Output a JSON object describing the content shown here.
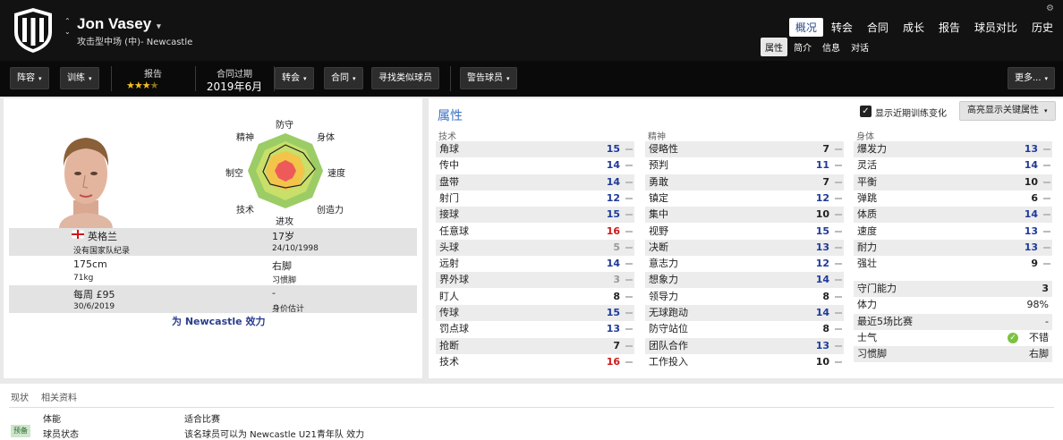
{
  "player": {
    "name": "Jon Vasey",
    "position": "攻击型中场 (中)- Newcastle"
  },
  "tabs": [
    "概况",
    "转会",
    "合同",
    "成长",
    "报告",
    "球员对比",
    "历史"
  ],
  "subtabs": [
    "属性",
    "简介",
    "信息",
    "对话"
  ],
  "toolbar": {
    "squad": "阵容",
    "training": "训练",
    "report_label": "报告",
    "report_stars": "★★★",
    "report_half": "★",
    "contract_label": "合同过期",
    "contract_value": "2019年6月",
    "transfer": "转会",
    "contract": "合同",
    "find_similar": "寻找类似球员",
    "warn": "警告球员",
    "more": "更多..."
  },
  "radar": {
    "defense": "防守",
    "physical": "身体",
    "speed": "速度",
    "creativity": "创造力",
    "attack": "进攻",
    "technique": "技术",
    "control": "制空",
    "mental": "精神"
  },
  "info": {
    "nation": "英格兰",
    "nation_note": "没有国家队纪录",
    "age": "17岁",
    "dob": "24/10/1998",
    "height": "175cm",
    "weight": "71kg",
    "foot": "右脚",
    "foot_label": "习惯脚",
    "wage": "每周 £95",
    "contract_end": "30/6/2019",
    "value": "-",
    "value_label": "身价估计",
    "plays_for": "为 Newcastle 效力"
  },
  "attributes": {
    "title": "属性",
    "show_training": "显示近期训练变化",
    "highlight": "高亮显示关键属性",
    "technical_header": "技术",
    "mental_header": "精神",
    "physical_header": "身体",
    "technical": [
      {
        "name": "角球",
        "value": "15",
        "color": "#1e3a9a"
      },
      {
        "name": "传中",
        "value": "14",
        "color": "#1e3a9a"
      },
      {
        "name": "盘带",
        "value": "14",
        "color": "#1e3a9a"
      },
      {
        "name": "射门",
        "value": "12",
        "color": "#1e3a9a"
      },
      {
        "name": "接球",
        "value": "15",
        "color": "#1e3a9a"
      },
      {
        "name": "任意球",
        "value": "16",
        "color": "#d01818"
      },
      {
        "name": "头球",
        "value": "5",
        "color": "#999999"
      },
      {
        "name": "远射",
        "value": "14",
        "color": "#1e3a9a"
      },
      {
        "name": "界外球",
        "value": "3",
        "color": "#999999"
      },
      {
        "name": "盯人",
        "value": "8",
        "color": "#222222"
      },
      {
        "name": "传球",
        "value": "15",
        "color": "#1e3a9a"
      },
      {
        "name": "罚点球",
        "value": "13",
        "color": "#1e3a9a"
      },
      {
        "name": "抢断",
        "value": "7",
        "color": "#222222"
      },
      {
        "name": "技术",
        "value": "16",
        "color": "#d01818"
      }
    ],
    "mental": [
      {
        "name": "侵略性",
        "value": "7",
        "color": "#222222"
      },
      {
        "name": "预判",
        "value": "11",
        "color": "#1e3a9a"
      },
      {
        "name": "勇敢",
        "value": "7",
        "color": "#222222"
      },
      {
        "name": "镇定",
        "value": "12",
        "color": "#1e3a9a"
      },
      {
        "name": "集中",
        "value": "10",
        "color": "#222222"
      },
      {
        "name": "视野",
        "value": "15",
        "color": "#1e3a9a"
      },
      {
        "name": "决断",
        "value": "13",
        "color": "#1e3a9a"
      },
      {
        "name": "意志力",
        "value": "12",
        "color": "#1e3a9a"
      },
      {
        "name": "想象力",
        "value": "14",
        "color": "#1e3a9a"
      },
      {
        "name": "领导力",
        "value": "8",
        "color": "#222222"
      },
      {
        "name": "无球跑动",
        "value": "14",
        "color": "#1e3a9a"
      },
      {
        "name": "防守站位",
        "value": "8",
        "color": "#222222"
      },
      {
        "name": "团队合作",
        "value": "13",
        "color": "#1e3a9a"
      },
      {
        "name": "工作投入",
        "value": "10",
        "color": "#222222"
      }
    ],
    "physical": [
      {
        "name": "爆发力",
        "value": "13",
        "color": "#1e3a9a"
      },
      {
        "name": "灵活",
        "value": "14",
        "color": "#1e3a9a"
      },
      {
        "name": "平衡",
        "value": "10",
        "color": "#222222"
      },
      {
        "name": "弹跳",
        "value": "6",
        "color": "#222222"
      },
      {
        "name": "体质",
        "value": "14",
        "color": "#1e3a9a"
      },
      {
        "name": "速度",
        "value": "13",
        "color": "#1e3a9a"
      },
      {
        "name": "耐力",
        "value": "13",
        "color": "#1e3a9a"
      },
      {
        "name": "强壮",
        "value": "9",
        "color": "#222222"
      }
    ],
    "extra": [
      {
        "name": "守门能力",
        "value": "3"
      },
      {
        "name": "体力",
        "value": "98%"
      },
      {
        "name": "最近5场比赛",
        "value": "-"
      },
      {
        "name": "士气",
        "value": "不错"
      },
      {
        "name": "习惯脚",
        "value": "右脚"
      }
    ]
  },
  "bottom": {
    "tab1": "现状",
    "tab2": "相关资料",
    "col1": "体能",
    "col2": "适合比赛",
    "badge": "预备",
    "row_label": "球员状态",
    "row_text": "该名球员可以为 Newcastle U21青年队 效力"
  }
}
